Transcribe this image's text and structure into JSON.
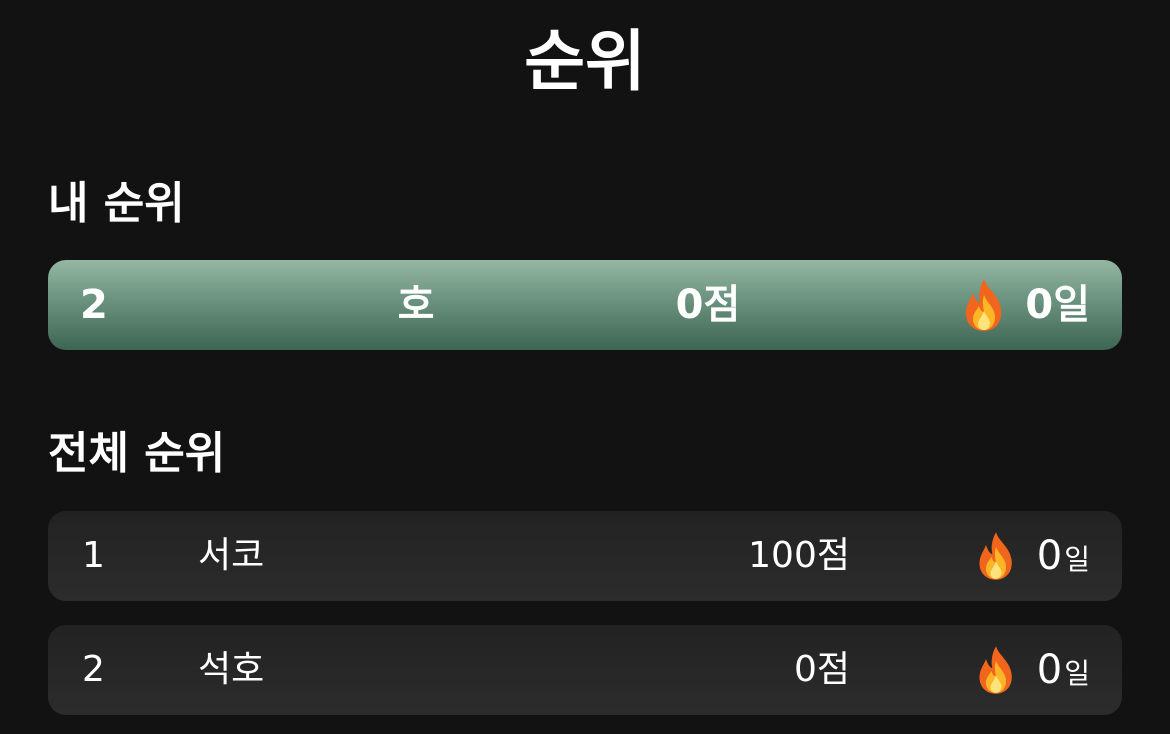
{
  "header": {
    "title": "순위"
  },
  "my_rank": {
    "section_title": "내 순위",
    "rank": "2",
    "name": "호",
    "score": "0점",
    "streak": "0일",
    "streak_icon": "fire-icon"
  },
  "all_rank": {
    "section_title": "전체 순위",
    "rows": [
      {
        "rank": "1",
        "name": "서코",
        "score": "100점",
        "streak_value": "0",
        "streak_unit": "일",
        "streak_icon": "fire-icon"
      },
      {
        "rank": "2",
        "name": "석호",
        "score": "0점",
        "streak_value": "0",
        "streak_unit": "일",
        "streak_icon": "fire-icon"
      }
    ]
  },
  "colors": {
    "background": "#121212",
    "my_card_top": "#95b7a2",
    "my_card_bottom": "#3d6553",
    "row_card": "#262626",
    "text": "#ffffff"
  }
}
